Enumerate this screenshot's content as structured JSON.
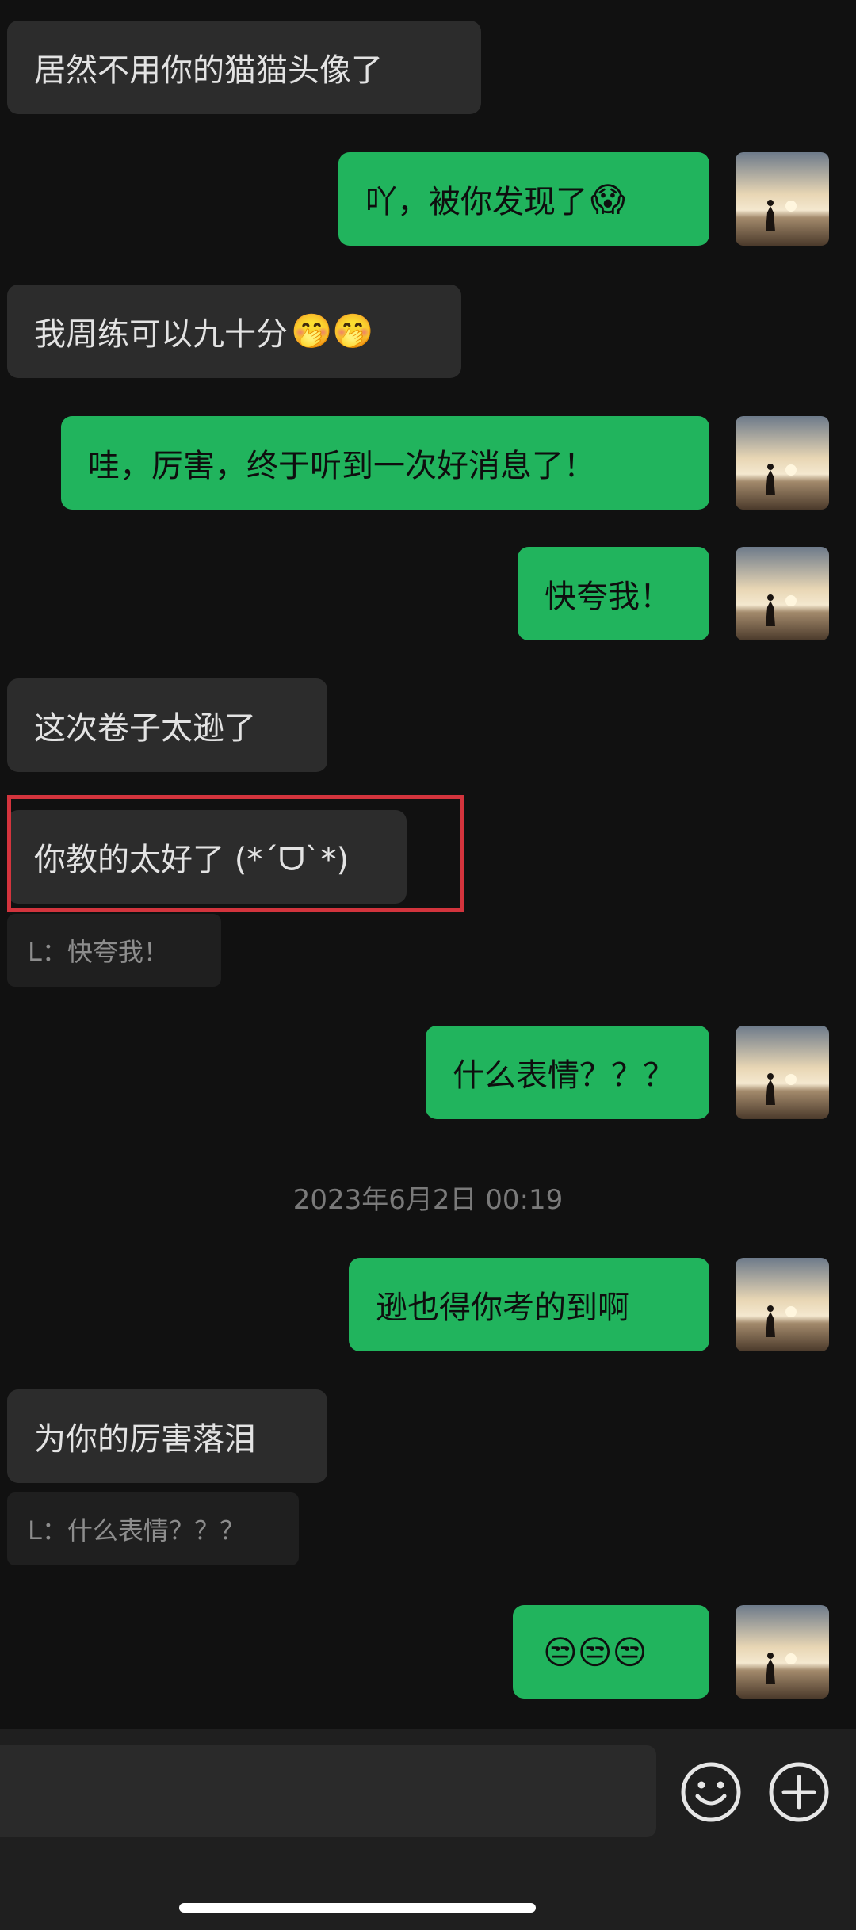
{
  "messages": [
    {
      "dir": "in",
      "text": "居然不用你的猫猫头像了"
    },
    {
      "dir": "out",
      "text": "吖，被你发现了",
      "emoji": "😱"
    },
    {
      "dir": "in",
      "text": "我周练可以九十分",
      "emoji": "🤭🤭"
    },
    {
      "dir": "out",
      "text": "哇，厉害，终于听到一次好消息了！"
    },
    {
      "dir": "out",
      "text": "快夸我！"
    },
    {
      "dir": "in",
      "text": "这次卷子太逊了"
    },
    {
      "dir": "in",
      "text": "你教的太好了 (*ˊᗜˋ*)",
      "quote": "L：快夸我！"
    },
    {
      "dir": "out",
      "text": "什么表情？？？"
    },
    {
      "dir": "out",
      "text": "逊也得你考的到啊"
    },
    {
      "dir": "in",
      "text": "为你的厉害落泪",
      "quote": "L：什么表情？？？"
    },
    {
      "dir": "out",
      "text": "",
      "emoji": "😒😒😒"
    }
  ],
  "timestamp": "2023年6月2日 00:19",
  "input": {
    "emoji_icon": "smile-icon",
    "plus_icon": "plus-icon"
  },
  "colors": {
    "outgoing": "#21b45d",
    "incoming": "#2c2c2c",
    "background": "#111111",
    "highlight": "#d3343d"
  }
}
